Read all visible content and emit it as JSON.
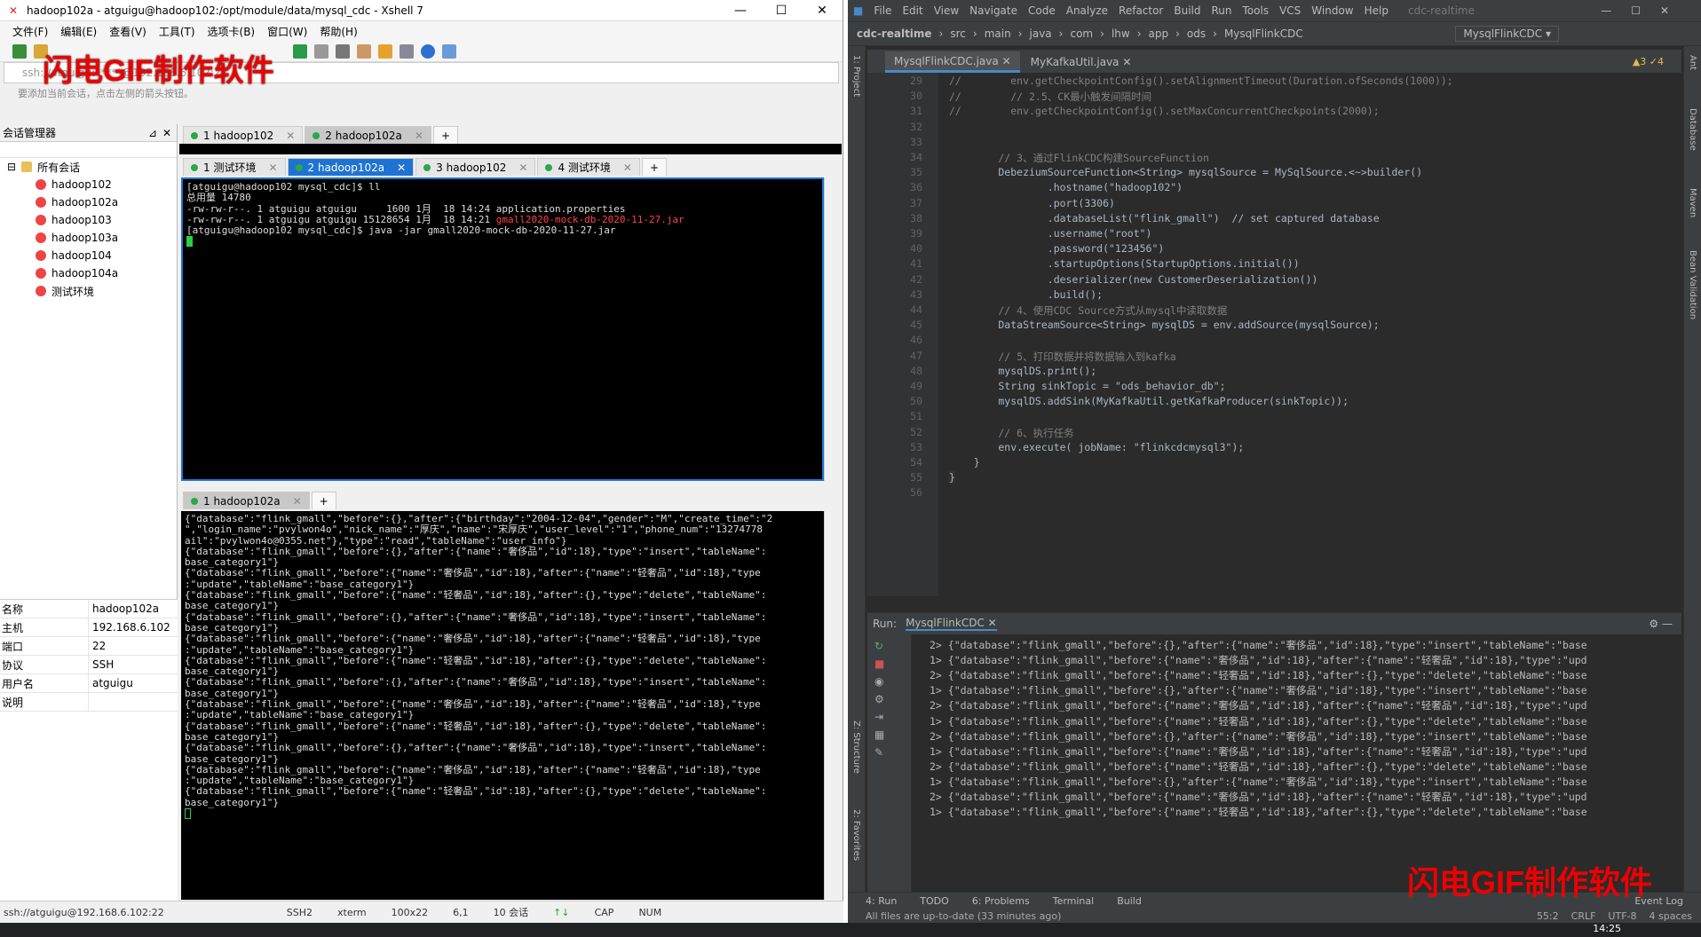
{
  "xshell": {
    "title": "hadoop102a - atguigu@hadoop102:/opt/module/data/mysql_cdc - Xshell 7",
    "menu": [
      "文件(F)",
      "编辑(E)",
      "查看(V)",
      "工具(T)",
      "选项卡(B)",
      "窗口(W)",
      "帮助(H)"
    ],
    "address": "ssh://atguigu:*****@192.168.6.102:22",
    "hint": "要添加当前会话，点击左侧的箭头按钮。",
    "watermark": "闪电GIF制作软件",
    "session_panel_title": "会话管理器",
    "sessions_root": "所有会话",
    "sessions": [
      "hadoop102",
      "hadoop102a",
      "hadoop103",
      "hadoop103a",
      "hadoop104",
      "hadoop104a",
      "测试环境"
    ],
    "top_tabs": [
      "1 hadoop102",
      "2 hadoop102a"
    ],
    "mid_tabs": [
      "1 测试环境",
      "2 hadoop102a",
      "3 hadoop102",
      "4 测试环境"
    ],
    "bottom_tabs": [
      "1 hadoop102a"
    ],
    "term1": [
      "[atguigu@hadoop102 mysql_cdc]$ ll",
      "总用量 14780",
      "-rw-rw-r--. 1 atguigu atguigu     1600 1月  18 14:24 application.properties",
      "-rw-rw-r--. 1 atguigu atguigu 15128654 1月  18 14:21 ",
      "[atguigu@hadoop102 mysql_cdc]$ java -jar gmall2020-mock-db-2020-11-27.jar"
    ],
    "term1_jar": "gmall2020-mock-db-2020-11-27.jar",
    "term2": [
      "{\"database\":\"flink_gmall\",\"before\":{},\"after\":{\"birthday\":\"2004-12-04\",\"gender\":\"M\",\"create_time\":\"2",
      "\",\"login_name\":\"pvylwon4o\",\"nick_name\":\"厚庆\",\"name\":\"宋厚庆\",\"user_level\":\"1\",\"phone_num\":\"13274778",
      "ail\":\"pvylwon4o@0355.net\"},\"type\":\"read\",\"tableName\":\"user_info\"}",
      "{\"database\":\"flink_gmall\",\"before\":{},\"after\":{\"name\":\"奢侈品\",\"id\":18},\"type\":\"insert\",\"tableName\":",
      "base_category1\"}",
      "{\"database\":\"flink_gmall\",\"before\":{\"name\":\"奢侈品\",\"id\":18},\"after\":{\"name\":\"轻奢品\",\"id\":18},\"type",
      ":\"update\",\"tableName\":\"base_category1\"}",
      "{\"database\":\"flink_gmall\",\"before\":{\"name\":\"轻奢品\",\"id\":18},\"after\":{},\"type\":\"delete\",\"tableName\":",
      "base_category1\"}",
      "{\"database\":\"flink_gmall\",\"before\":{},\"after\":{\"name\":\"奢侈品\",\"id\":18},\"type\":\"insert\",\"tableName\":",
      "base_category1\"}",
      "{\"database\":\"flink_gmall\",\"before\":{\"name\":\"奢侈品\",\"id\":18},\"after\":{\"name\":\"轻奢品\",\"id\":18},\"type",
      ":\"update\",\"tableName\":\"base_category1\"}",
      "{\"database\":\"flink_gmall\",\"before\":{\"name\":\"轻奢品\",\"id\":18},\"after\":{},\"type\":\"delete\",\"tableName\":",
      "base_category1\"}",
      "{\"database\":\"flink_gmall\",\"before\":{},\"after\":{\"name\":\"奢侈品\",\"id\":18},\"type\":\"insert\",\"tableName\":",
      "base_category1\"}",
      "{\"database\":\"flink_gmall\",\"before\":{\"name\":\"奢侈品\",\"id\":18},\"after\":{\"name\":\"轻奢品\",\"id\":18},\"type",
      ":\"update\",\"tableName\":\"base_category1\"}",
      "{\"database\":\"flink_gmall\",\"before\":{\"name\":\"轻奢品\",\"id\":18},\"after\":{},\"type\":\"delete\",\"tableName\":",
      "base_category1\"}",
      "{\"database\":\"flink_gmall\",\"before\":{},\"after\":{\"name\":\"奢侈品\",\"id\":18},\"type\":\"insert\",\"tableName\":",
      "base_category1\"}",
      "{\"database\":\"flink_gmall\",\"before\":{\"name\":\"奢侈品\",\"id\":18},\"after\":{\"name\":\"轻奢品\",\"id\":18},\"type",
      ":\"update\",\"tableName\":\"base_category1\"}",
      "{\"database\":\"flink_gmall\",\"before\":{\"name\":\"轻奢品\",\"id\":18},\"after\":{},\"type\":\"delete\",\"tableName\":",
      "base_category1\"}"
    ],
    "props": [
      {
        "k": "名称",
        "v": "hadoop102a"
      },
      {
        "k": "主机",
        "v": "192.168.6.102"
      },
      {
        "k": "端口",
        "v": "22"
      },
      {
        "k": "协议",
        "v": "SSH"
      },
      {
        "k": "用户名",
        "v": "atguigu"
      },
      {
        "k": "说明",
        "v": ""
      }
    ],
    "status": [
      "ssh://atguigu@192.168.6.102:22",
      "SSH2",
      "xterm",
      "100x22",
      "6,1",
      "10 会话",
      "CAP",
      "NUM"
    ]
  },
  "idea": {
    "menu": [
      "File",
      "Edit",
      "View",
      "Navigate",
      "Code",
      "Analyze",
      "Refactor",
      "Build",
      "Run",
      "Tools",
      "VCS",
      "Window",
      "Help"
    ],
    "project": "cdc-realtime",
    "crumbs": [
      "cdc-realtime",
      "src",
      "main",
      "java",
      "com",
      "lhw",
      "app",
      "ods",
      "MysqlFlinkCDC"
    ],
    "run_config": "MysqlFlinkCDC",
    "tabs": [
      "MysqlFlinkCDC.java",
      "MyKafkaUtil.java"
    ],
    "inspections": "▲3  ✓4",
    "left_tools": [
      "1: Project",
      "Z: Structure",
      "2: Favorites"
    ],
    "right_tools": [
      "Ant",
      "Database",
      "Maven",
      "Bean Validation"
    ],
    "code": [
      {
        "n": "29",
        "t": "//        env.getCheckpointConfig().setAlignmentTimeout(Duration.ofSeconds(1000));",
        "c": "cm"
      },
      {
        "n": "30",
        "t": "//        // 2.5、CK最小触发间隔时间",
        "c": "cm"
      },
      {
        "n": "31",
        "t": "//        env.getCheckpointConfig().setMaxConcurrentCheckpoints(2000);",
        "c": "cm"
      },
      {
        "n": "32",
        "t": "",
        "c": ""
      },
      {
        "n": "33",
        "t": "",
        "c": ""
      },
      {
        "n": "34",
        "t": "        // 3、通过FlinkCDC构建SourceFunction",
        "c": "cm"
      },
      {
        "n": "35",
        "t": "        DebeziumSourceFunction<String> mysqlSource = MySqlSource.<~>builder()",
        "c": ""
      },
      {
        "n": "36",
        "t": "                .hostname(\"hadoop102\")",
        "c": ""
      },
      {
        "n": "37",
        "t": "                .port(3306)",
        "c": ""
      },
      {
        "n": "38",
        "t": "                .databaseList(\"flink_gmall\")  // set captured database",
        "c": ""
      },
      {
        "n": "39",
        "t": "                .username(\"root\")",
        "c": ""
      },
      {
        "n": "40",
        "t": "                .password(\"123456\")",
        "c": ""
      },
      {
        "n": "41",
        "t": "                .startupOptions(StartupOptions.initial())",
        "c": ""
      },
      {
        "n": "42",
        "t": "                .deserializer(new CustomerDeserialization())",
        "c": ""
      },
      {
        "n": "43",
        "t": "                .build();",
        "c": ""
      },
      {
        "n": "44",
        "t": "        // 4、使用CDC Source方式从mysql中读取数据",
        "c": "cm"
      },
      {
        "n": "45",
        "t": "        DataStreamSource<String> mysqlDS = env.addSource(mysqlSource);",
        "c": ""
      },
      {
        "n": "46",
        "t": "",
        "c": ""
      },
      {
        "n": "47",
        "t": "        // 5、打印数据并将数据输入到kafka",
        "c": "cm"
      },
      {
        "n": "48",
        "t": "        mysqlDS.print();",
        "c": ""
      },
      {
        "n": "49",
        "t": "        String sinkTopic = \"ods_behavior_db\";",
        "c": ""
      },
      {
        "n": "50",
        "t": "        mysqlDS.addSink(MyKafkaUtil.getKafkaProducer(sinkTopic));",
        "c": ""
      },
      {
        "n": "51",
        "t": "",
        "c": ""
      },
      {
        "n": "52",
        "t": "        // 6、执行任务",
        "c": "cm"
      },
      {
        "n": "53",
        "t": "        env.execute( jobName: \"flinkcdcmysql3\");",
        "c": ""
      },
      {
        "n": "54",
        "t": "    }",
        "c": ""
      },
      {
        "n": "55",
        "t": "}",
        "c": "hl"
      },
      {
        "n": "56",
        "t": "",
        "c": ""
      }
    ],
    "run_title": "Run:",
    "run_tab": "MysqlFlinkCDC",
    "run_lines": [
      "2> {\"database\":\"flink_gmall\",\"before\":{},\"after\":{\"name\":\"奢侈品\",\"id\":18},\"type\":\"insert\",\"tableName\":\"base",
      "1> {\"database\":\"flink_gmall\",\"before\":{\"name\":\"奢侈品\",\"id\":18},\"after\":{\"name\":\"轻奢品\",\"id\":18},\"type\":\"upd",
      "2> {\"database\":\"flink_gmall\",\"before\":{\"name\":\"轻奢品\",\"id\":18},\"after\":{},\"type\":\"delete\",\"tableName\":\"base",
      "1> {\"database\":\"flink_gmall\",\"before\":{},\"after\":{\"name\":\"奢侈品\",\"id\":18},\"type\":\"insert\",\"tableName\":\"base",
      "2> {\"database\":\"flink_gmall\",\"before\":{\"name\":\"奢侈品\",\"id\":18},\"after\":{\"name\":\"轻奢品\",\"id\":18},\"type\":\"upd",
      "1> {\"database\":\"flink_gmall\",\"before\":{\"name\":\"轻奢品\",\"id\":18},\"after\":{},\"type\":\"delete\",\"tableName\":\"base",
      "2> {\"database\":\"flink_gmall\",\"before\":{},\"after\":{\"name\":\"奢侈品\",\"id\":18},\"type\":\"insert\",\"tableName\":\"base",
      "1> {\"database\":\"flink_gmall\",\"before\":{\"name\":\"奢侈品\",\"id\":18},\"after\":{\"name\":\"轻奢品\",\"id\":18},\"type\":\"upd",
      "2> {\"database\":\"flink_gmall\",\"before\":{\"name\":\"轻奢品\",\"id\":18},\"after\":{},\"type\":\"delete\",\"tableName\":\"base",
      "1> {\"database\":\"flink_gmall\",\"before\":{},\"after\":{\"name\":\"奢侈品\",\"id\":18},\"type\":\"insert\",\"tableName\":\"base",
      "2> {\"database\":\"flink_gmall\",\"before\":{\"name\":\"奢侈品\",\"id\":18},\"after\":{\"name\":\"轻奢品\",\"id\":18},\"type\":\"upd",
      "1> {\"database\":\"flink_gmall\",\"before\":{\"name\":\"轻奢品\",\"id\":18},\"after\":{},\"type\":\"delete\",\"tableName\":\"base"
    ],
    "bottom_tools": [
      "4: Run",
      "TODO",
      "6: Problems",
      "Terminal",
      "Build"
    ],
    "event_log": "Event Log",
    "status_msg": "All files are up-to-date (33 minutes ago)",
    "status_right": [
      "55:2",
      "CRLF",
      "UTF-8",
      "4 spaces"
    ],
    "watermark": "闪电GIF制作软件"
  },
  "taskbar": {
    "time": "14:25"
  }
}
